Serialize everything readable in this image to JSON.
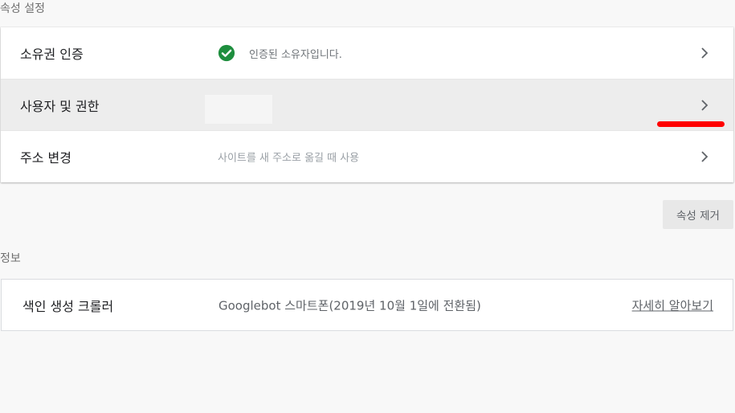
{
  "property_settings": {
    "heading": "속성 설정",
    "rows": [
      {
        "label": "소유권 인증",
        "value": "인증된 소유자입니다.",
        "icon": "check-circle-icon"
      },
      {
        "label": "사용자 및 권한",
        "value": ""
      },
      {
        "label": "주소 변경",
        "value": "사이트를 새 주소로 옮길 때 사용"
      }
    ],
    "remove_button": "속성 제거"
  },
  "info": {
    "heading": "정보",
    "rows": [
      {
        "label": "색인 생성 크롤러",
        "value": "Googlebot 스마트폰(2019년 10월 1일에 전환됨)",
        "link": "자세히 알아보기"
      }
    ]
  },
  "colors": {
    "check_green": "#1e8e3e",
    "highlight_red": "#ff0000",
    "hover_row": "#ededed"
  }
}
